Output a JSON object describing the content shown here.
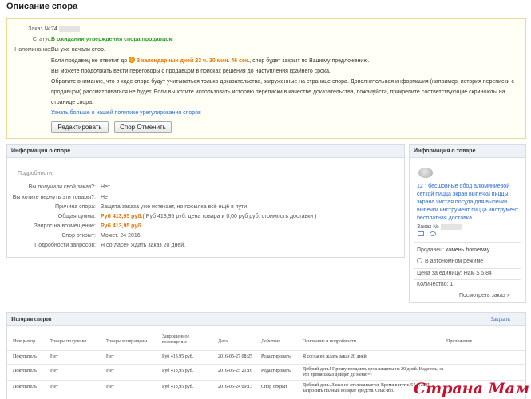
{
  "page": {
    "title": "Описание спора"
  },
  "summary": {
    "order_label": "Заказ №:",
    "order_value": "74",
    "status_label": "Статус:",
    "status_value": "В ожидании утверждения спора продавцом",
    "reminder_label": "Напоминание:",
    "reminder_value": "Вы уже начали спор.",
    "deadline_prefix": "Если продавец не ответит до",
    "deadline_time": "3 календарных дней 23 ч. 30 мин. 46 сек.",
    "deadline_suffix": ", спор будет закрыт по Вашему предложению.",
    "negotiate_text": "Вы можете продолжать вести переговоры с продавцом в поисках решения до наступления крайнего срока.",
    "notice_line1": "Обратите внимание, что в ходе спора будут учитываться только доказательства, загруженные на странице спора. Дополнительная информация (например, история переписки с",
    "notice_line2": "продавцом) рассматриваться не будет. Если вы хотите использовать историю переписки в качестве доказательства, пожалуйста, прикрепите соответствующие скриншоты на",
    "notice_line3": "странице спора.",
    "policy_link": "Узнать больше о нашей политике урегулирования споров",
    "edit_button": "Редактировать",
    "cancel_button": "Спор Отменить"
  },
  "dispute_info": {
    "header": "Информация о споре",
    "details_label": "Подробности:",
    "rows": [
      {
        "label": "Вы получили свой заказ?:",
        "value": "Нет"
      },
      {
        "label": "Вы хотите вернуть эти товары?:",
        "value": "Нет"
      },
      {
        "label": "Причина спора:",
        "value": "Защита заказа уже истекает, но посылка всё ещё в пути"
      },
      {
        "label": "Общая сумма:",
        "value": "Руб 413,95 руб.",
        "extra": "( Руб 413,95 руб. цена товара и 0,00 руб руб. стоимость доставки )"
      },
      {
        "label": "Запрос на возмещение:",
        "value": "Руб 413,95 руб."
      },
      {
        "label": "Спор открыт:",
        "value": "Может. 24 2016"
      },
      {
        "label": "Подробности запросов:",
        "value": "Я согласен ждать заказ 20 дней."
      }
    ]
  },
  "product_info": {
    "header": "Информация о товаре",
    "title": "12 \" бесшовные обод алюминиевой сеткой пицца экран выпечки пиццы экрана чистая посуда для выпечки выпечки инструмент пицца инструмент бесплатная доставка",
    "order_label": "Заказ №",
    "seller_label": "Продавец:",
    "seller_value": "камень homeway",
    "offline_text": "В автономном режиме",
    "unit_price_label": "Цена за единицу:",
    "unit_price_value": "Нам $ 5.84",
    "quantity_label": "Количество:",
    "quantity_value": "1",
    "view_order_link": "Посмотреть заказ »"
  },
  "history": {
    "title": "История споров",
    "close_link": "Закрыть",
    "columns": [
      "Инициатор",
      "Товары получены",
      "Товары возвращены",
      "Запрошенное возмещение",
      "Дата",
      "Действие",
      "Основание и подробности",
      "Приложение"
    ],
    "rows": [
      {
        "initiator": "Покупатель",
        "received": "Нет",
        "returned": "Нет",
        "refund": "Руб 413,95 руб.",
        "date": "2016-05-27 08:25",
        "action": "Редактировать",
        "details1": "Я согласен ждать заказ 20 дней.",
        "details2": ""
      },
      {
        "initiator": "Покупатель",
        "received": "Нет",
        "returned": "Нет",
        "refund": "Руб 413,95 руб.",
        "date": "2016-05-25 21:16",
        "action": "Редактировать",
        "details1": "Добрый день! Прошу продлить срок защиты на 20 дней. Надеюсь, за",
        "details2": "это время заказ дойдет до меня =)"
      },
      {
        "initiator": "Покупатель",
        "received": "Нет",
        "returned": "Нет",
        "refund": "Руб 413,95 руб.",
        "date": "2016-05-24 09:13",
        "action": "Спор открыт",
        "details1": "Добрый день. Заказ не отслеживается Время в пути: 54 дня. Я",
        "details2": "запросить полный возврат средств. Спасибо."
      }
    ]
  },
  "watermark": "Страна Мам"
}
